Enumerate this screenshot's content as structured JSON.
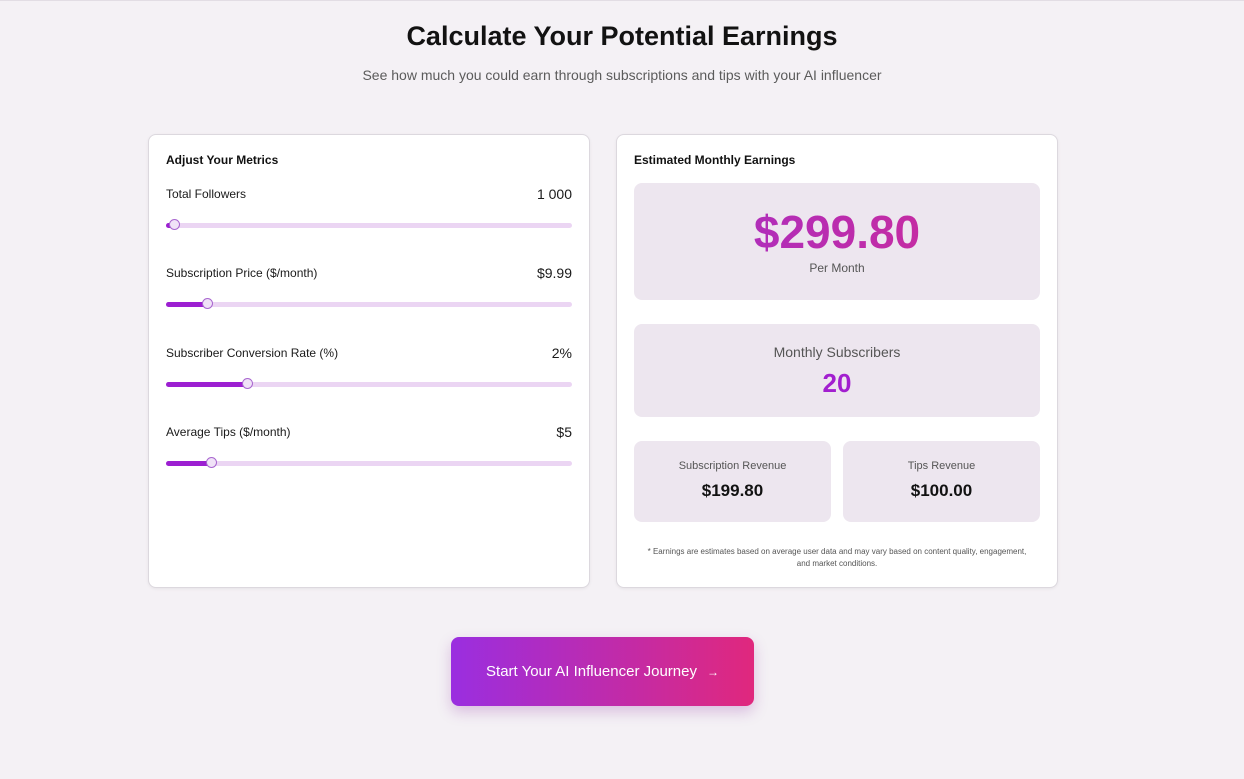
{
  "header": {
    "title": "Calculate Your Potential Earnings",
    "subtitle": "See how much you could earn through subscriptions and tips with your AI influencer"
  },
  "metrics_card": {
    "title": "Adjust Your Metrics",
    "metrics": [
      {
        "label": "Total Followers",
        "value": "1 000",
        "fraction": 0.02
      },
      {
        "label": "Subscription Price ($/month)",
        "value": "$9.99",
        "fraction": 0.1
      },
      {
        "label": "Subscriber Conversion Rate (%)",
        "value": "2%",
        "fraction": 0.2
      },
      {
        "label": "Average Tips ($/month)",
        "value": "$5",
        "fraction": 0.11
      }
    ]
  },
  "earnings_card": {
    "title": "Estimated Monthly Earnings",
    "total_amount": "$299.80",
    "total_caption": "Per Month",
    "subscribers_label": "Monthly Subscribers",
    "subscribers_count": "20",
    "subscription_revenue_label": "Subscription Revenue",
    "subscription_revenue_value": "$199.80",
    "tips_revenue_label": "Tips Revenue",
    "tips_revenue_value": "$100.00",
    "disclaimer": "* Earnings are estimates based on average user data and may vary based on content quality, engagement, and market conditions."
  },
  "cta": {
    "label": "Start Your AI Influencer Journey",
    "icon": "arrow-right-icon"
  },
  "colors": {
    "accent_purple": "#9c1fd1",
    "accent_pink": "#e0287d",
    "track": "#ebd5f3",
    "panel": "#ede6ef",
    "background": "#f4f1f5"
  }
}
